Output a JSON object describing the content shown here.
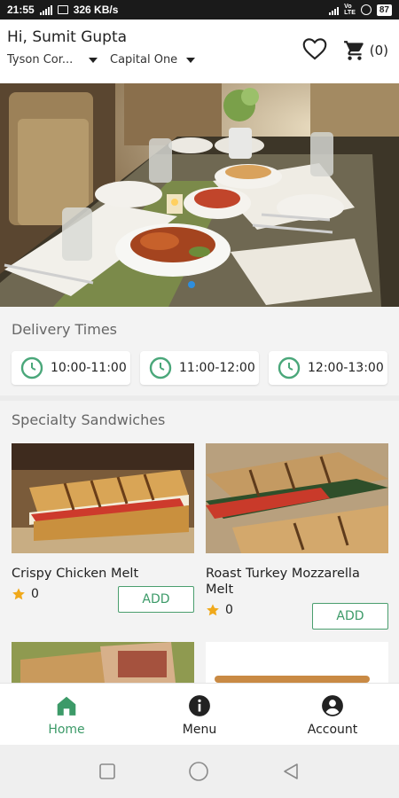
{
  "status_bar": {
    "time": "21:55",
    "speed": "326 KB/s",
    "battery": "87"
  },
  "header": {
    "greeting": "Hi, Sumit Gupta",
    "location": "Tyson Cor...",
    "bank": "Capital One",
    "cart_count": "(0)"
  },
  "delivery": {
    "title": "Delivery Times",
    "slots": [
      "10:00-11:00",
      "11:00-12:00",
      "12:00-13:00"
    ]
  },
  "specialty": {
    "title": "Specialty Sandwiches",
    "products": [
      {
        "name": "Crispy Chicken Melt",
        "rating": "0",
        "add_label": "ADD"
      },
      {
        "name": "Roast Turkey Mozzarella Melt",
        "rating": "0",
        "add_label": "ADD"
      }
    ]
  },
  "nav": {
    "items": [
      {
        "label": "Home",
        "icon": "home-icon",
        "active": true
      },
      {
        "label": "Menu",
        "icon": "info-icon",
        "active": false
      },
      {
        "label": "Account",
        "icon": "account-icon",
        "active": false
      }
    ]
  },
  "colors": {
    "accent": "#3c9a68",
    "clock": "#4aa77a",
    "star": "#f0a91b",
    "carousel_dot": "#2e8ede"
  }
}
